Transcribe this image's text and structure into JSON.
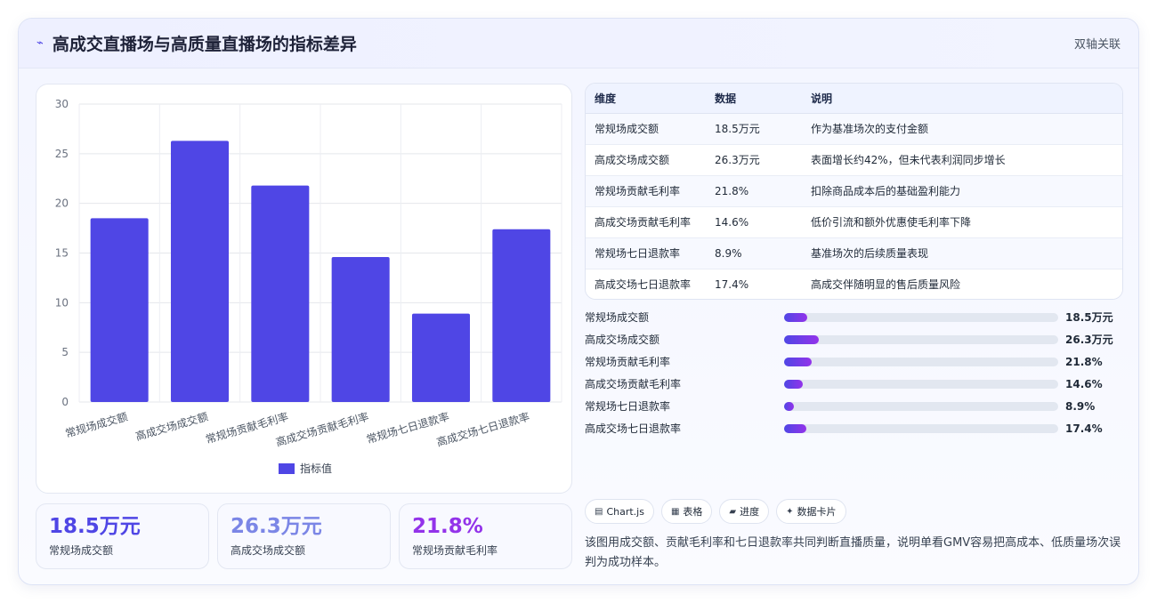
{
  "header": {
    "title": "高成交直播场与高质量直播场的指标差异",
    "badge": "双轴关联",
    "icon": "trend-line-icon"
  },
  "chart_data": {
    "type": "bar",
    "categories": [
      "常规场成交额",
      "高成交场成交额",
      "常规场贡献毛利率",
      "高成交场贡献毛利率",
      "常规场七日退款率",
      "高成交场七日退款率"
    ],
    "series": [
      {
        "name": "指标值",
        "values": [
          18.5,
          26.3,
          21.8,
          14.6,
          8.9,
          17.4
        ]
      }
    ],
    "ylim": [
      0,
      30
    ],
    "yticks": [
      "0",
      "5",
      "10",
      "15",
      "20",
      "25",
      "30"
    ],
    "color": "#4f46e5",
    "grid": true,
    "legend": "bottom"
  },
  "kpis": [
    {
      "value": "18.5万元",
      "label": "常规场成交额",
      "color": "#4f46e5"
    },
    {
      "value": "26.3万元",
      "label": "高成交场成交额",
      "color": "#7b86e6"
    },
    {
      "value": "21.8%",
      "label": "常规场贡献毛利率",
      "color": "#9333ea"
    }
  ],
  "table": {
    "headers": [
      "维度",
      "数据",
      "说明"
    ],
    "rows": [
      [
        "常规场成交额",
        "18.5万元",
        "作为基准场次的支付金额"
      ],
      [
        "高成交场成交额",
        "26.3万元",
        "表面增长约42%，但未代表利润同步增长"
      ],
      [
        "常规场贡献毛利率",
        "21.8%",
        "扣除商品成本后的基础盈利能力"
      ],
      [
        "高成交场贡献毛利率",
        "14.6%",
        "低价引流和额外优惠使毛利率下降"
      ],
      [
        "常规场七日退款率",
        "8.9%",
        "基准场次的后续质量表现"
      ],
      [
        "高成交场七日退款率",
        "17.4%",
        "高成交伴随明显的售后质量风险"
      ]
    ]
  },
  "progress": [
    {
      "label": "常规场成交额",
      "value": "18.5万元",
      "fraction": 0.085
    },
    {
      "label": "高成交场成交额",
      "value": "26.3万元",
      "fraction": 0.125
    },
    {
      "label": "常规场贡献毛利率",
      "value": "21.8%",
      "fraction": 0.1
    },
    {
      "label": "高成交场贡献毛利率",
      "value": "14.6%",
      "fraction": 0.068
    },
    {
      "label": "常规场七日退款率",
      "value": "8.9%",
      "fraction": 0.037
    },
    {
      "label": "高成交场七日退款率",
      "value": "17.4%",
      "fraction": 0.08
    }
  ],
  "chips": [
    {
      "icon": "monitor-icon",
      "glyph": "▤",
      "label": "Chart.js"
    },
    {
      "icon": "table-icon",
      "glyph": "▦",
      "label": "表格"
    },
    {
      "icon": "progress-icon",
      "glyph": "▰",
      "label": "进度"
    },
    {
      "icon": "sparkle-icon",
      "glyph": "✦",
      "label": "数据卡片"
    }
  ],
  "note": "该图用成交额、贡献毛利率和七日退款率共同判断直播质量，说明单看GMV容易把高成本、低质量场次误判为成功样本。"
}
